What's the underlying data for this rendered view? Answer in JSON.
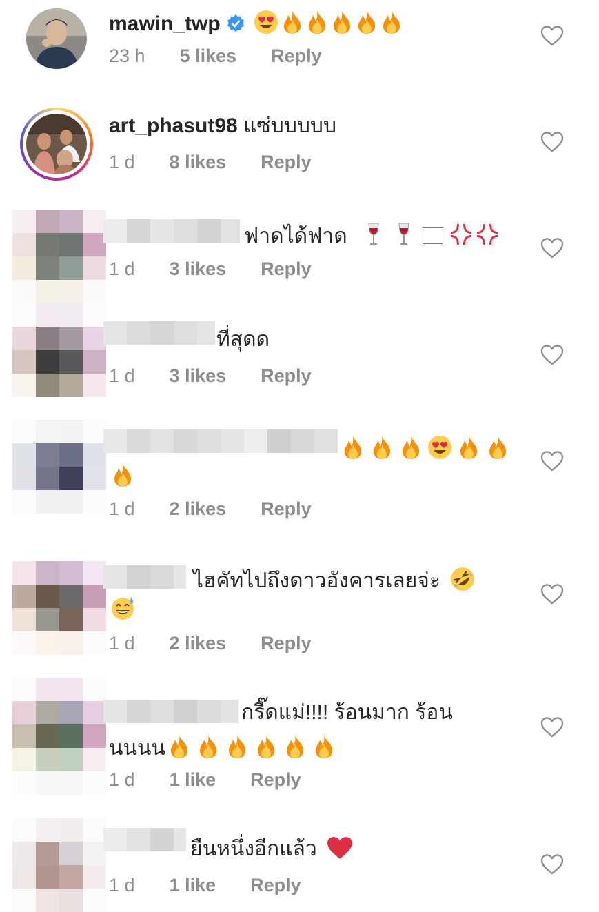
{
  "comments": [
    {
      "username": "mawin_twp",
      "verified": true,
      "text": "",
      "time": "23 h",
      "likes": "5 likes",
      "reply": "Reply"
    },
    {
      "username": "art_phasut98",
      "text": "แซ่บบบบบ",
      "time": "1 d",
      "likes": "8 likes",
      "reply": "Reply"
    },
    {
      "username": "",
      "text": "ฟาดได้ฟาด",
      "time": "1 d",
      "likes": "3 likes",
      "reply": "Reply"
    },
    {
      "username": "",
      "text": "ที่สุดด",
      "time": "1 d",
      "likes": "3 likes",
      "reply": "Reply"
    },
    {
      "username": "",
      "text": "",
      "time": "1 d",
      "likes": "2 likes",
      "reply": "Reply"
    },
    {
      "username": "",
      "text": "ไฮคัทไปถึงดาวอังคารเลยจ่ะ",
      "time": "1 d",
      "likes": "2 likes",
      "reply": "Reply"
    },
    {
      "username": "",
      "text": "กรี๊ดแม่!!!! ร้อนมาก ร้อน",
      "text2": "นนนน",
      "time": "1 d",
      "likes": "1 like",
      "reply": "Reply"
    },
    {
      "username": "",
      "text": "ยืนหนึ่งอีกแล้ว",
      "time": "1 d",
      "likes": "1 like",
      "reply": "Reply"
    }
  ],
  "icons": {
    "like": "heart-outline-icon",
    "verified": "verified-badge-icon",
    "fire": "fire-emoji",
    "heart_eyes": "heart-eyes-emoji",
    "wine": "wine-glass-emoji",
    "anger": "anger-emoji",
    "rofl": "rolling-laughing-emoji",
    "sweat_smile": "sweat-smile-emoji",
    "red_heart": "red-heart-emoji"
  },
  "colors": {
    "verified": "#3897f0",
    "meta": "#8e8e8e",
    "text": "#262626"
  }
}
